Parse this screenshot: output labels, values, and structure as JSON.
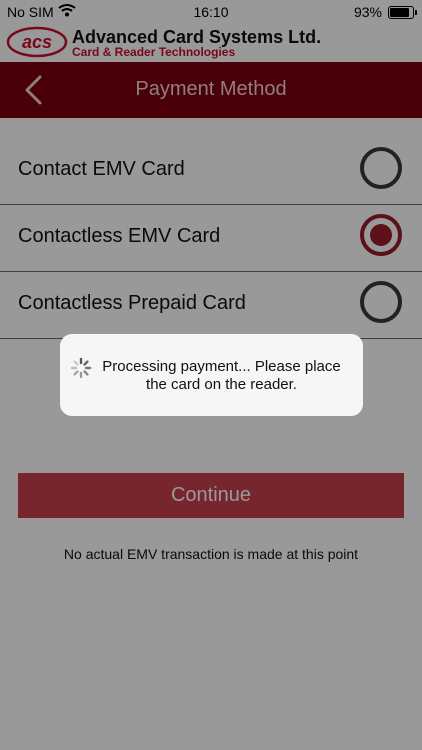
{
  "status_bar": {
    "carrier": "No SIM",
    "time": "16:10",
    "battery_percent": "93%",
    "battery_level": 0.93
  },
  "brand": {
    "logo_text": "acs",
    "company": "Advanced Card Systems Ltd.",
    "tagline": "Card & Reader Technologies"
  },
  "nav": {
    "title": "Payment Method",
    "back_icon": "chevron-left-icon"
  },
  "options": [
    {
      "label": "Contact EMV Card",
      "selected": false
    },
    {
      "label": "Contactless EMV Card",
      "selected": true
    },
    {
      "label": "Contactless Prepaid Card",
      "selected": false
    }
  ],
  "continue_label": "Continue",
  "footnote": "No actual EMV transaction is made at this point",
  "hud": {
    "message": "Processing payment... Please place the card on the reader.",
    "icon": "spinner-icon"
  },
  "colors": {
    "nav_background": "#7a0010",
    "accent": "#9a1b28",
    "button": "#c8404d",
    "brand_red": "#c8102e"
  }
}
